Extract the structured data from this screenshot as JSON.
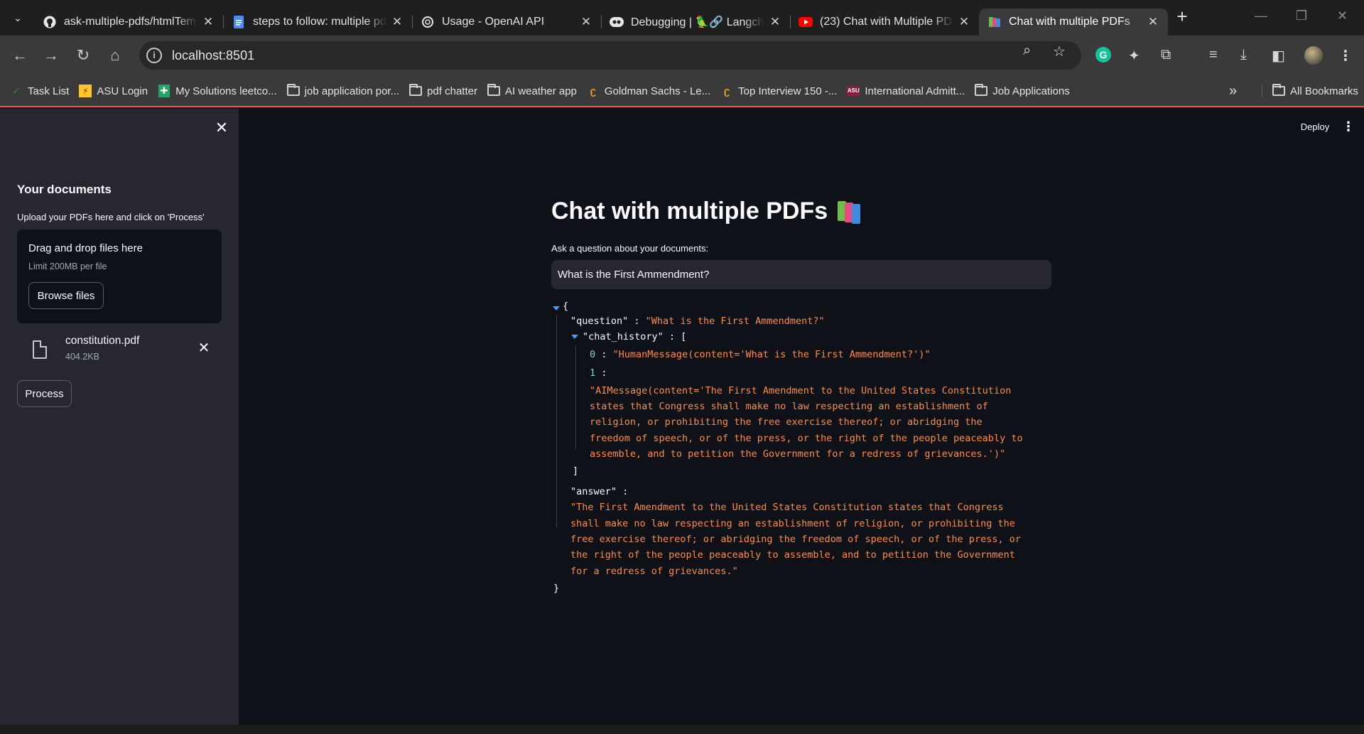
{
  "browser": {
    "tabs": [
      {
        "title": "ask-multiple-pdfs/htmlTem",
        "icon": "github-icon",
        "active": false
      },
      {
        "title": "steps to follow: multiple pd",
        "icon": "docs-icon",
        "active": false
      },
      {
        "title": "Usage - OpenAI API",
        "icon": "openai-icon",
        "active": false
      },
      {
        "title": "Debugging | 🦜🔗 Langch",
        "icon": "langsmith-icon",
        "active": false
      },
      {
        "title": "(23) Chat with Multiple PDF",
        "icon": "youtube-icon",
        "active": false
      },
      {
        "title": "Chat with multiple PDFs",
        "icon": "books-icon",
        "active": true
      }
    ],
    "address": "localhost:8501",
    "bookmarks": [
      {
        "label": "Task List",
        "icon": "check-icon"
      },
      {
        "label": "ASU Login",
        "icon": "asu-icon"
      },
      {
        "label": "My Solutions leetco...",
        "icon": "sheets-icon"
      },
      {
        "label": "job application por...",
        "icon": "folder-icon"
      },
      {
        "label": "pdf chatter",
        "icon": "folder-icon"
      },
      {
        "label": "AI weather app",
        "icon": "folder-icon"
      },
      {
        "label": "Goldman Sachs - Le...",
        "icon": "leetcode-icon"
      },
      {
        "label": "Top Interview 150 -...",
        "icon": "leetcode-icon"
      },
      {
        "label": "International Admitt...",
        "icon": "asu-icon"
      },
      {
        "label": "Job Applications",
        "icon": "folder-icon"
      }
    ],
    "all_bookmarks": "All Bookmarks"
  },
  "sidebar": {
    "title": "Your documents",
    "upload_label": "Upload your PDFs here and click on 'Process'",
    "dropzone_title": "Drag and drop files here",
    "dropzone_limit": "Limit 200MB per file",
    "browse_label": "Browse files",
    "file": {
      "name": "constitution.pdf",
      "size": "404.2KB"
    },
    "process_label": "Process"
  },
  "header": {
    "deploy_label": "Deploy"
  },
  "main": {
    "title": "Chat with multiple PDFs",
    "question_label": "Ask a question about your documents:",
    "question_value": "What is the First Ammendment?",
    "json": {
      "question_key": "\"question\"",
      "question_val": "\"What is the First Ammendment?\"",
      "chat_history_key": "\"chat_history\"",
      "item0_idx": "0",
      "item0_val": "\"HumanMessage(content='What is the First Ammendment?')\"",
      "item1_idx": "1",
      "item1_lines": [
        "\"AIMessage(content='The First Amendment to the United States Constitution",
        "states that Congress shall make no law respecting an establishment of",
        "religion, or prohibiting the free exercise thereof; or abridging the",
        "freedom of speech, or of the press, or the right of the people peaceably to",
        "assemble, and to petition the Government for a redress of grievances.')\""
      ],
      "answer_key": "\"answer\"",
      "answer_lines": [
        "\"The First Amendment to the United States Constitution states that Congress",
        "shall make no law respecting an establishment of religion, or prohibiting the",
        "free exercise thereof; or abridging the freedom of speech, or of the press, or",
        "the right of the people peaceably to assemble, and to petition the Government",
        "for a redress of grievances.\""
      ]
    }
  },
  "colors": {
    "accent": "#ff4b4b",
    "json_string": "#ff8c42",
    "json_index": "#7fd4c9",
    "caret": "#4a9af5"
  }
}
